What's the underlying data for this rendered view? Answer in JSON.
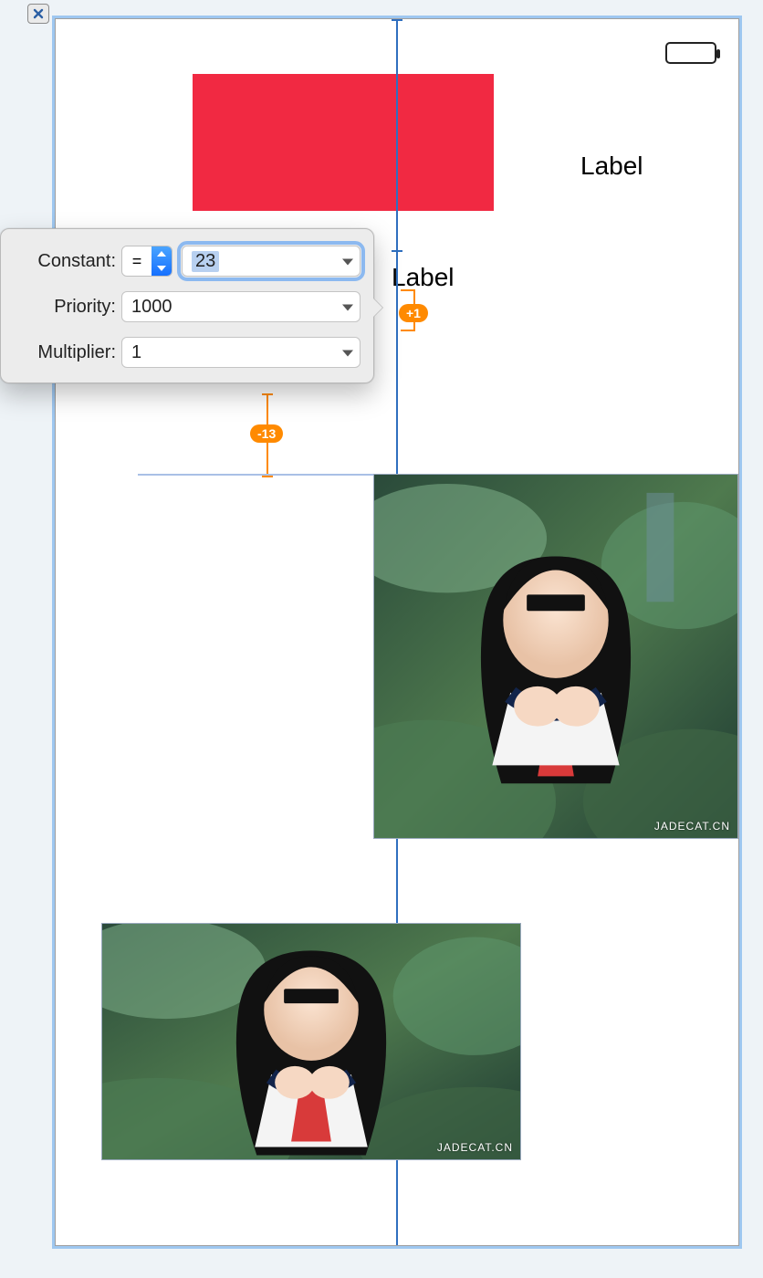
{
  "constraint_editor": {
    "constant_label": "Constant:",
    "constant_relation": "=",
    "constant_value": "23",
    "priority_label": "Priority:",
    "priority_value": "1000",
    "multiplier_label": "Multiplier:",
    "multiplier_value": "1"
  },
  "canvas": {
    "labels": {
      "label_1": "Label",
      "label_2": "Label"
    },
    "constraint_badges": {
      "plus1": "+1",
      "minus13": "-13"
    },
    "watermark": "JADECAT.CN"
  }
}
